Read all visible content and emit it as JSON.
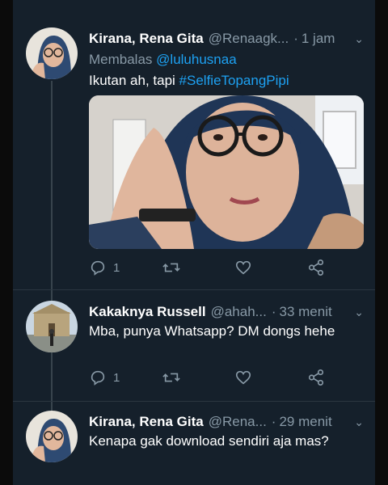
{
  "tweets": [
    {
      "name": "Kirana, Rena Gita",
      "handle": "@Renaagk...",
      "time": "1 jam",
      "reply_label": "Membalas",
      "reply_mention": "@luluhusnaa",
      "text": "Ikutan ah, tapi",
      "hashtag": "#SelfieTopangPipi",
      "reply_count": "1",
      "retweet_count": "",
      "like_count": ""
    },
    {
      "name": "Kakaknya Russell",
      "handle": "@ahah...",
      "time": "33 menit",
      "text": "Mba, punya Whatsapp? DM dongs hehe",
      "reply_count": "1",
      "retweet_count": "",
      "like_count": ""
    },
    {
      "name": "Kirana, Rena Gita",
      "handle": "@Rena...",
      "time": "29 menit",
      "text": "Kenapa gak download sendiri aja mas?"
    }
  ],
  "icons": {
    "reply": "reply-icon",
    "retweet": "retweet-icon",
    "like": "heart-icon",
    "share": "share-icon",
    "menu": "chevron-down-icon"
  },
  "colors": {
    "background": "#15202b",
    "accent": "#1da1f2",
    "secondary_text": "#8899a6"
  }
}
